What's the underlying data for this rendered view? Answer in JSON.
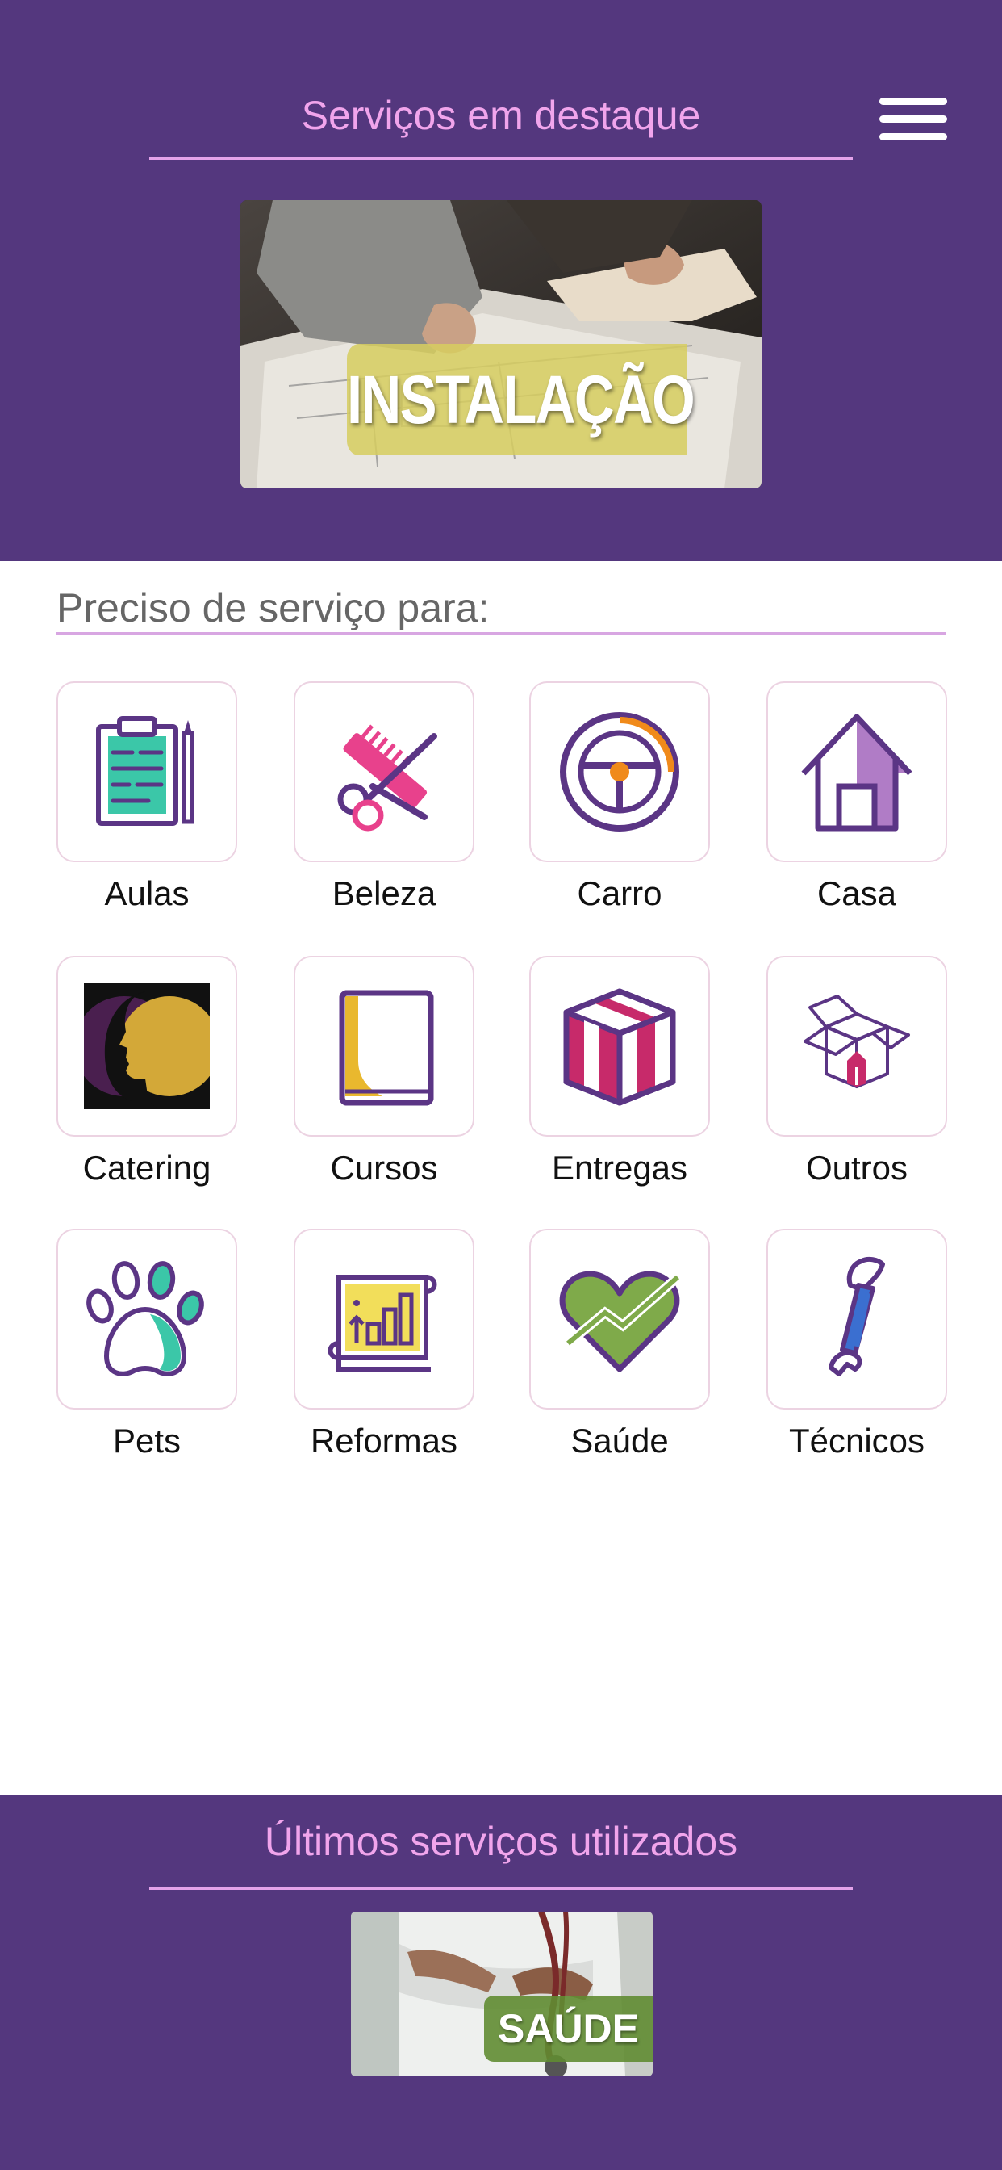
{
  "header": {
    "title": "Serviços em destaque",
    "menu_icon": "hamburger-menu-icon",
    "featured_banner": {
      "label": "INSTALAÇÃO",
      "image": "blueprint-drawing-photo"
    }
  },
  "categories": {
    "title": "Preciso de serviço para:",
    "items": [
      {
        "label": "Aulas",
        "icon": "clipboard-pencil-icon"
      },
      {
        "label": "Beleza",
        "icon": "scissors-comb-icon"
      },
      {
        "label": "Carro",
        "icon": "steering-wheel-icon"
      },
      {
        "label": "Casa",
        "icon": "house-icon"
      },
      {
        "label": "Catering",
        "icon": "face-silhouette-icon"
      },
      {
        "label": "Cursos",
        "icon": "book-icon"
      },
      {
        "label": "Entregas",
        "icon": "package-box-icon"
      },
      {
        "label": "Outros",
        "icon": "open-box-icon"
      },
      {
        "label": "Pets",
        "icon": "paw-icon"
      },
      {
        "label": "Reformas",
        "icon": "blueprint-chart-icon"
      },
      {
        "label": "Saúde",
        "icon": "heart-pulse-icon"
      },
      {
        "label": "Técnicos",
        "icon": "wrench-icon"
      }
    ]
  },
  "recent": {
    "title": "Últimos serviços utilizados",
    "items": [
      {
        "label": "SAÚDE",
        "image": "doctor-stethoscope-photo"
      }
    ]
  },
  "colors": {
    "brand_purple": "#54377e",
    "accent_pink": "#f1a5ec",
    "icon_purple": "#5b3585",
    "icon_teal": "#3bc7a8",
    "icon_orange": "#f08a1a",
    "icon_yellow": "#e9b82e",
    "icon_magenta": "#c72a6a",
    "icon_green": "#7faa4a",
    "icon_blue": "#3b6fd0"
  }
}
